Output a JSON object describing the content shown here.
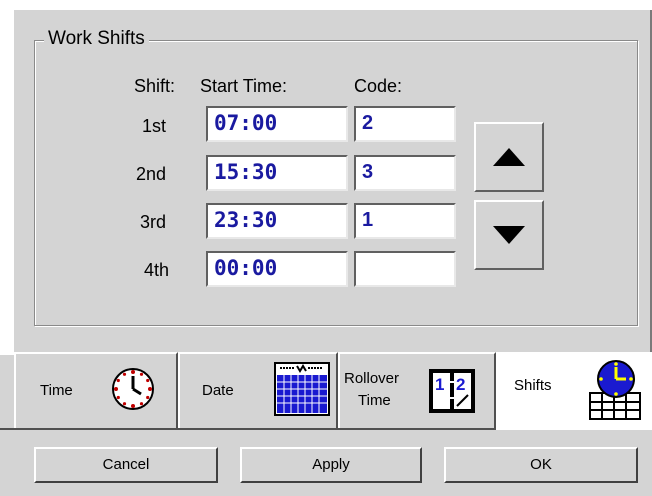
{
  "group": {
    "title": "Work Shifts"
  },
  "headers": {
    "shift": "Shift:",
    "start_time": "Start Time:",
    "code": "Code:"
  },
  "shifts": [
    {
      "label": "1st",
      "start": "07:00",
      "code": "2"
    },
    {
      "label": "2nd",
      "start": "15:30",
      "code": "3"
    },
    {
      "label": "3rd",
      "start": "23:30",
      "code": "1"
    },
    {
      "label": "4th",
      "start": "00:00",
      "code": ""
    }
  ],
  "spin": {
    "up_icon": "triangle-up-icon",
    "down_icon": "triangle-down-icon"
  },
  "tabs": [
    {
      "label": "Time",
      "icon": "clock-icon",
      "active": false
    },
    {
      "label": "Date",
      "icon": "calendar-icon",
      "active": false
    },
    {
      "label_line1": "Rollover",
      "label_line2": "Time",
      "icon": "rollover-icon",
      "active": false
    },
    {
      "label": "Shifts",
      "icon": "shifts-clock-icon",
      "active": true
    }
  ],
  "buttons": {
    "cancel": "Cancel",
    "apply": "Apply",
    "ok": "OK"
  },
  "colors": {
    "field_text": "#1a1aa0",
    "background": "#d4d4d4"
  }
}
